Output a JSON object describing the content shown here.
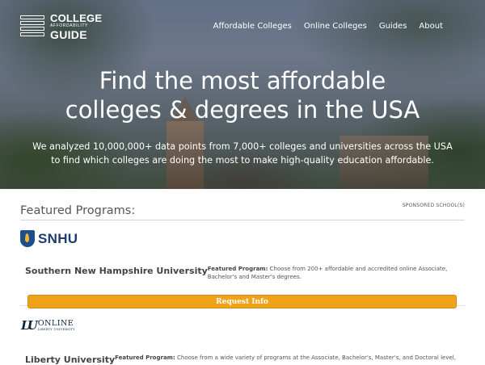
{
  "header": {
    "logo": {
      "line1": "COLLEGE",
      "line2": "AFFORDABILITY",
      "line3": "GUIDE"
    },
    "nav": [
      {
        "label": "Affordable Colleges"
      },
      {
        "label": "Online Colleges"
      },
      {
        "label": "Guides"
      },
      {
        "label": "About"
      }
    ]
  },
  "hero": {
    "headline_line1": "Find the most affordable",
    "headline_line2": "colleges & degrees in the USA",
    "subtext_line1": "We analyzed 10,000,000+ data points from 7,000+ colleges and universities across the USA",
    "subtext_line2": "to find which colleges are doing the most to make high-quality education affordable."
  },
  "featured": {
    "title": "Featured Programs:",
    "sponsored_label": "SPONSORED SCHOOL(S)",
    "schools": [
      {
        "logo_text": "SNHU",
        "name": "Southern New Hampshire University",
        "program_label": "Featured Program:",
        "program_text_line1": " Choose from 200+ affordable and accredited online Associate,",
        "program_text_line2": "Bachelor's and Master's degrees.",
        "button_label": "Request Info"
      },
      {
        "logo_mark": "LU",
        "logo_text": "ONLINE",
        "logo_sub": "LIBERTY UNIVERSITY",
        "name": "Liberty University",
        "program_label": "Featured Program:",
        "program_text_line1": " Choose from a wide variety of programs at the Associate, Bachelor's, Master's, and Doctoral level,"
      }
    ]
  },
  "colors": {
    "accent_button": "#f0a21a",
    "snhu_blue": "#1d4f8c",
    "liberty_navy": "#0c2340"
  }
}
